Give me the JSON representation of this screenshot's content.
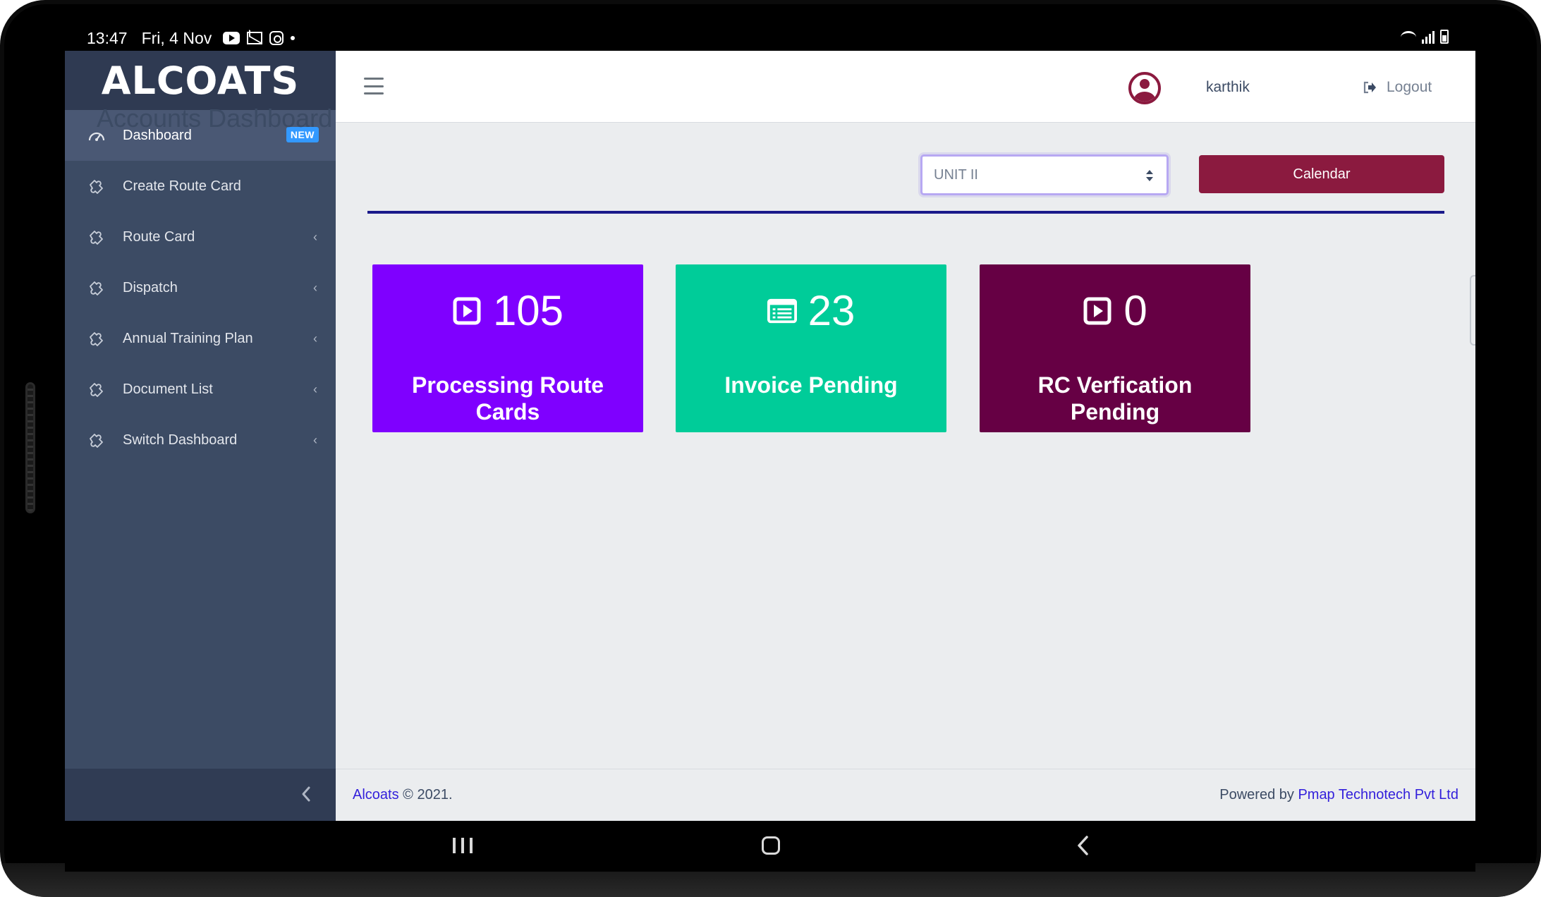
{
  "status_bar": {
    "time": "13:47",
    "date": "Fri, 4 Nov"
  },
  "sidebar": {
    "brand": "ALCOATS",
    "items": [
      {
        "label": "Dashboard",
        "badge": "NEW",
        "icon": "dashboard-speedometer-icon",
        "active": true
      },
      {
        "label": "Create Route Card",
        "icon": "puzzle-icon"
      },
      {
        "label": "Route Card",
        "icon": "puzzle-icon",
        "has_submenu": true
      },
      {
        "label": "Dispatch",
        "icon": "puzzle-icon",
        "has_submenu": true
      },
      {
        "label": "Annual Training Plan",
        "icon": "puzzle-icon",
        "has_submenu": true
      },
      {
        "label": "Document List",
        "icon": "puzzle-icon",
        "has_submenu": true
      },
      {
        "label": "Switch Dashboard",
        "icon": "puzzle-icon",
        "has_submenu": true
      }
    ]
  },
  "header": {
    "username": "karthik",
    "logout_label": "Logout"
  },
  "main": {
    "title": "Accounts Dashboard",
    "unit_select": {
      "value": "UNIT II"
    },
    "calendar_label": "Calendar",
    "cards": [
      {
        "count": "105",
        "label": "Processing Route Cards",
        "icon": "play-square-icon",
        "color": "#7f00ff"
      },
      {
        "count": "23",
        "label": "Invoice Pending",
        "icon": "list-icon",
        "color": "#00cc99"
      },
      {
        "count": "0",
        "label": "RC Verfication Pending",
        "icon": "play-square-icon",
        "color": "#660044"
      }
    ]
  },
  "footer": {
    "brand_link": "Alcoats",
    "copyright": "© 2021.",
    "powered_by": "Powered by",
    "company_link": "Pmap Technotech Pvt Ltd"
  },
  "colors": {
    "sidebar_bg": "#3c4b64",
    "accent": "#8b1a3f",
    "link": "#321fdb",
    "divider": "#1a1a8a"
  }
}
